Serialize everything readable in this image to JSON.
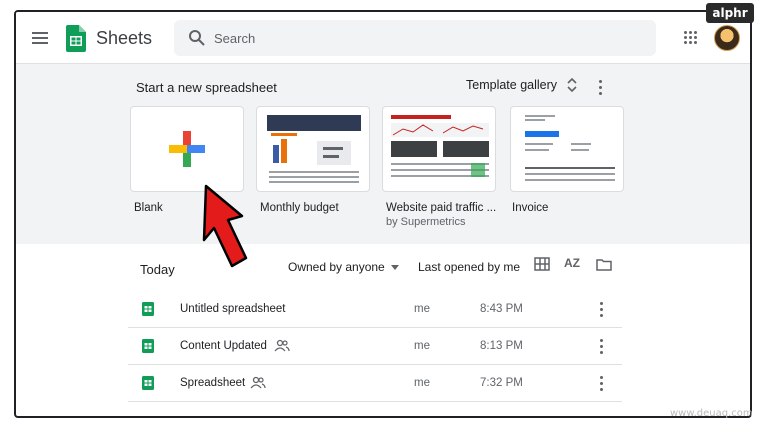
{
  "brand_badge": "alphr",
  "header": {
    "app_title": "Sheets",
    "search_placeholder": "Search"
  },
  "templates": {
    "heading": "Start a new spreadsheet",
    "gallery_label": "Template gallery",
    "items": [
      {
        "label": "Blank",
        "sub": ""
      },
      {
        "label": "Monthly budget",
        "sub": ""
      },
      {
        "label": "Website paid traffic ...",
        "sub": "by Supermetrics"
      },
      {
        "label": "Invoice",
        "sub": ""
      }
    ]
  },
  "recent": {
    "section_title": "Today",
    "owner_filter": "Owned by anyone",
    "sort_label": "Last opened by me",
    "sort_icon_text": "AZ",
    "rows": [
      {
        "name": "Untitled spreadsheet",
        "shared": false,
        "owner": "me",
        "time": "8:43 PM"
      },
      {
        "name": "Content Updated",
        "shared": true,
        "owner": "me",
        "time": "8:13 PM"
      },
      {
        "name": "Spreadsheet",
        "shared": true,
        "owner": "me",
        "time": "7:32 PM"
      }
    ]
  },
  "watermark": "www.deuaq.com",
  "colors": {
    "sheets_green": "#0F9D58",
    "google_red": "#EA4335",
    "google_blue": "#4285F4",
    "google_yellow": "#FBBC04",
    "google_green": "#34A853",
    "annotation_arrow": "#E31B1B"
  }
}
